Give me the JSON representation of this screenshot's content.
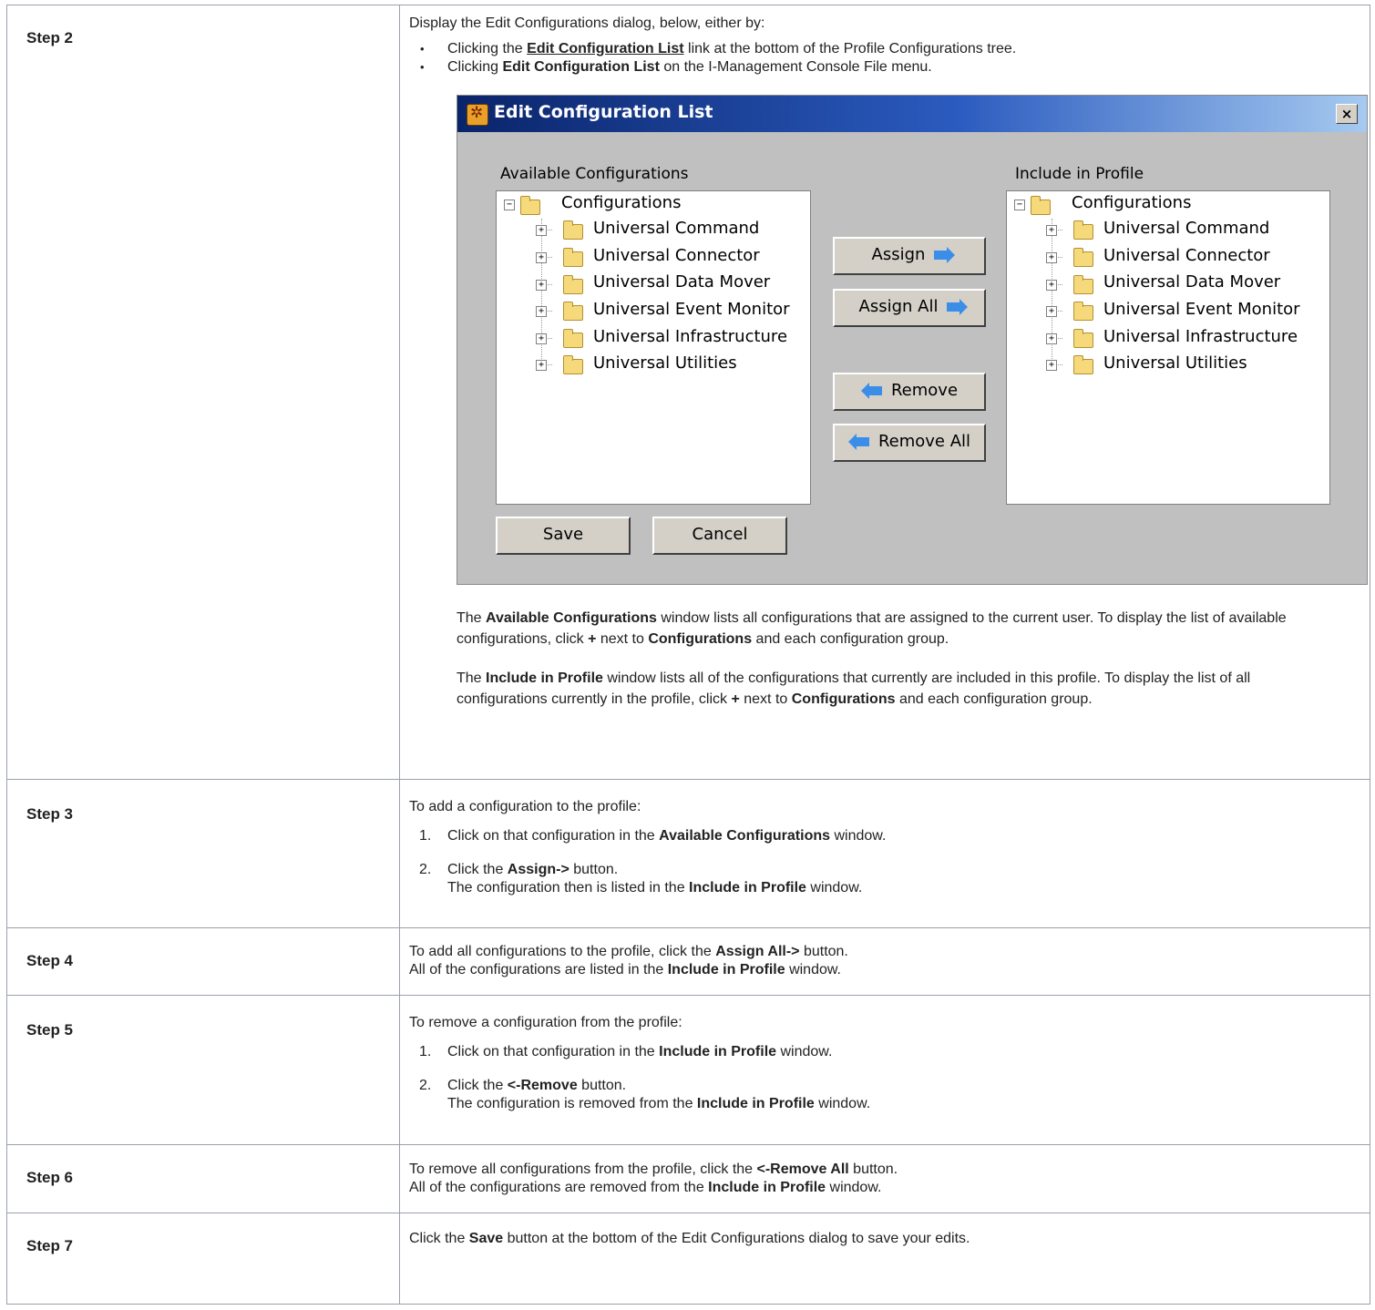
{
  "steps": {
    "step2": {
      "label": "Step 2",
      "intro": "Display the Edit Configurations dialog, below, either by:",
      "bullet1_pre": "Clicking the ",
      "bullet1_link": "Edit Configuration List",
      "bullet1_post": " link at the bottom of the Profile Configurations tree.",
      "bullet2_pre": "Clicking ",
      "bullet2_bold": "Edit Configuration List",
      "bullet2_post": " on the I-Management Console File menu.",
      "para1_pre": "The ",
      "para1_bold1": "Available Configurations",
      "para1_mid": " window lists all configurations that are assigned to the current user. To display the list of available configurations, click ",
      "para1_plus": "+",
      "para1_mid2": " next to ",
      "para1_bold2": "Configurations",
      "para1_post": " and each configuration group.",
      "para2_pre": "The ",
      "para2_bold1": "Include in Profile",
      "para2_mid": " window lists all of the configurations that currently are included in this profile. To display the list of all configurations currently in the profile, click ",
      "para2_plus": "+",
      "para2_mid2": " next to ",
      "para2_bold2": "Configurations",
      "para2_post": " and each configuration group."
    },
    "step3": {
      "label": "Step 3",
      "intro": "To add a configuration to the profile:",
      "item1_num": "1.",
      "item1_pre": "Click on that configuration in the ",
      "item1_bold": "Available Configurations",
      "item1_post": " window.",
      "item2_num": "2.",
      "item2_pre": "Click the ",
      "item2_bold": "Assign->",
      "item2_post": " button.",
      "item2_line2_pre": "The configuration then is listed in the ",
      "item2_line2_bold": "Include in Profile",
      "item2_line2_post": " window."
    },
    "step4": {
      "label": "Step 4",
      "line1_pre": "To add all configurations to the profile, click the ",
      "line1_bold": "Assign All->",
      "line1_post": " button.",
      "line2_pre": "All of the configurations are listed in the ",
      "line2_bold": "Include in Profile",
      "line2_post": " window."
    },
    "step5": {
      "label": "Step 5",
      "intro": "To remove a configuration from the profile:",
      "item1_num": "1.",
      "item1_pre": "Click on that configuration in the ",
      "item1_bold": "Include in Profile",
      "item1_post": " window.",
      "item2_num": "2.",
      "item2_pre": "Click the ",
      "item2_bold": "<-Remove",
      "item2_post": " button.",
      "item2_line2_pre": "The configuration is removed from the ",
      "item2_line2_bold": "Include in Profile",
      "item2_line2_post": " window."
    },
    "step6": {
      "label": "Step 6",
      "line1_pre": "To remove all configurations from the profile, click the ",
      "line1_bold": "<-Remove All",
      "line1_post": " button.",
      "line2_pre": "All of the configurations are removed from the ",
      "line2_bold": "Include in Profile",
      "line2_post": " window."
    },
    "step7": {
      "label": "Step 7",
      "line1_pre": "Click the ",
      "line1_bold": "Save",
      "line1_post": " button at the bottom of the Edit Configurations dialog to save your edits."
    }
  },
  "dialog": {
    "title": "Edit Configuration List",
    "close": "×",
    "available_label": "Available Configurations",
    "include_label": "Include in Profile",
    "root": "Configurations",
    "groups": [
      "Universal Command",
      "Universal Connector",
      "Universal Data Mover",
      "Universal Event Monitor",
      "Universal Infrastructure",
      "Universal Utilities"
    ],
    "assign": "Assign",
    "assign_all": "Assign All",
    "remove": "Remove",
    "remove_all": "Remove All",
    "save": "Save",
    "cancel": "Cancel"
  }
}
